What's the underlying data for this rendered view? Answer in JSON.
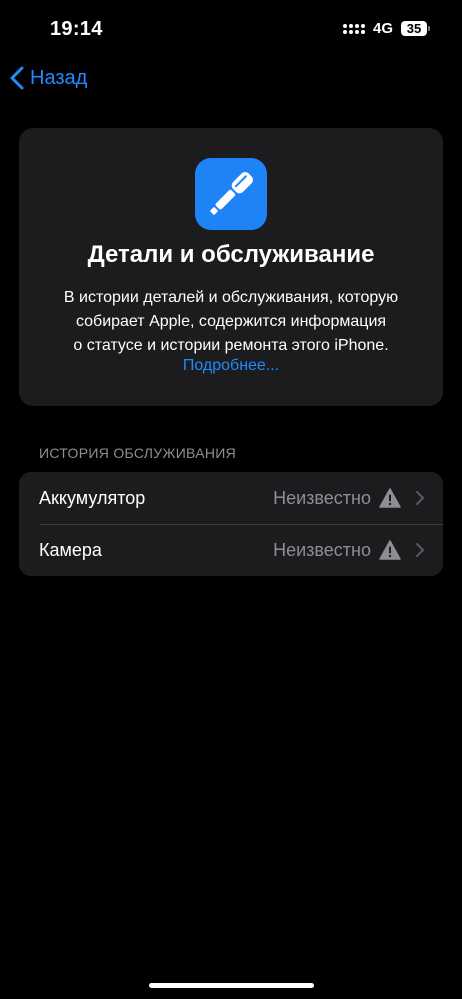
{
  "status_bar": {
    "time": "19:14",
    "network": "4G",
    "battery": "35"
  },
  "nav": {
    "back_label": "Назад"
  },
  "card": {
    "icon": "screwdriver-icon",
    "title": "Детали и обслуживание",
    "description_lines": [
      "В истории деталей и обслуживания, которую",
      "собирает Apple, содержится информация",
      "о статусе и истории ремонта этого iPhone."
    ],
    "link": "Подробнее..."
  },
  "section": {
    "header": "ИСТОРИЯ ОБСЛУЖИВАНИЯ",
    "rows": [
      {
        "label": "Аккумулятор",
        "value": "Неизвестно",
        "icon": "warning-icon"
      },
      {
        "label": "Камера",
        "value": "Неизвестно",
        "icon": "warning-icon"
      }
    ]
  },
  "colors": {
    "background": "#000000",
    "card": "#1c1c1e",
    "accent": "#1f8bff",
    "icon_tile": "#1e83f5",
    "secondary_text": "#8e8e93"
  }
}
